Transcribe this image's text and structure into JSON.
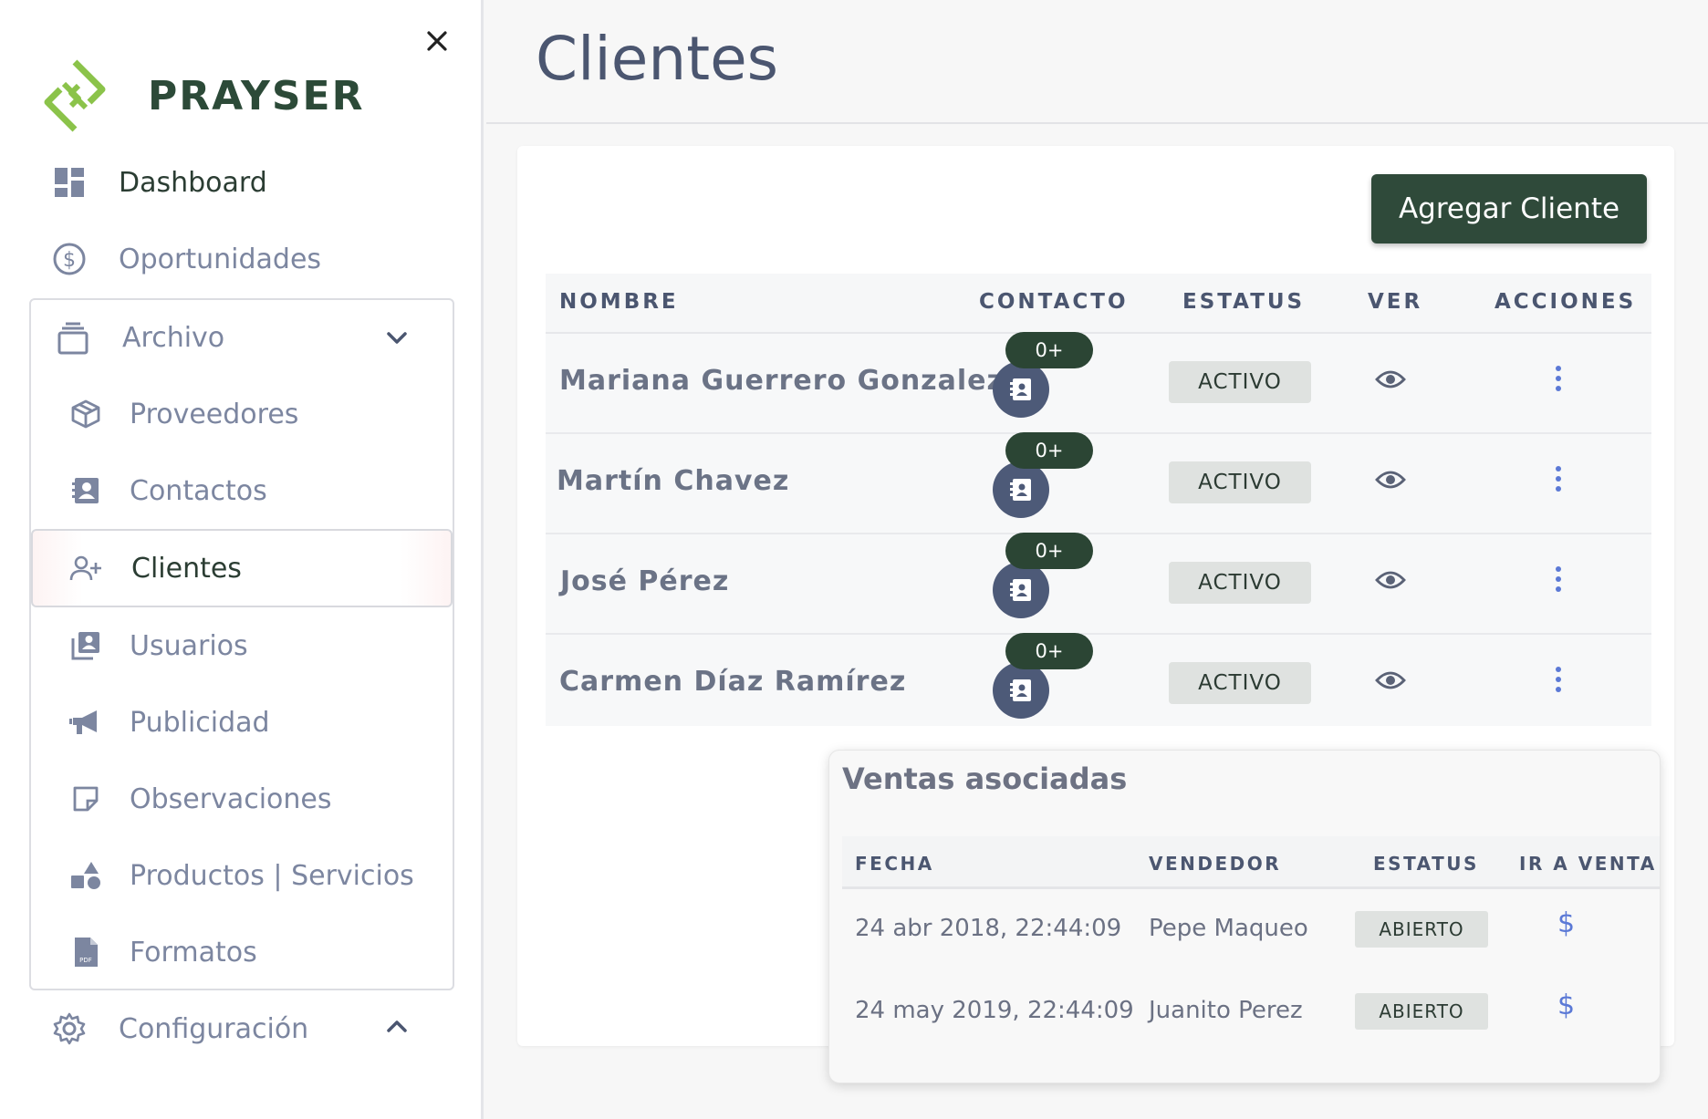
{
  "brand": {
    "name": "PRAYSER",
    "color": "#2c4a38",
    "accent": "#8bc34a"
  },
  "sidebar": {
    "items": [
      {
        "label": "Dashboard",
        "icon": "dashboard-icon"
      },
      {
        "label": "Oportunidades",
        "icon": "dollar-circle-icon"
      },
      {
        "label": "Archivo",
        "icon": "archive-icon"
      },
      {
        "label": "Proveedores",
        "icon": "box-icon"
      },
      {
        "label": "Contactos",
        "icon": "contact-book-icon"
      },
      {
        "label": "Clientes",
        "icon": "user-plus-icon",
        "active": true
      },
      {
        "label": "Usuarios",
        "icon": "user-cards-icon"
      },
      {
        "label": "Publicidad",
        "icon": "megaphone-icon"
      },
      {
        "label": "Observaciones",
        "icon": "note-icon"
      },
      {
        "label": "Productos | Servicios",
        "icon": "shapes-icon"
      },
      {
        "label": "Formatos",
        "icon": "pdf-file-icon"
      },
      {
        "label": "Configuración",
        "icon": "gear-icon"
      }
    ]
  },
  "page": {
    "title": "Clientes"
  },
  "actions": {
    "add_label": "Agregar Cliente"
  },
  "table": {
    "columns": [
      "NOMBRE",
      "CONTACTO",
      "ESTATUS",
      "VER",
      "ACCIONES"
    ],
    "rows": [
      {
        "name": "Mariana Guerrero Gonzalez",
        "contact_badge": "0+",
        "status": "ACTIVO"
      },
      {
        "name": "Martín Chavez",
        "contact_badge": "0+",
        "status": "ACTIVO"
      },
      {
        "name": "José Pérez",
        "contact_badge": "0+",
        "status": "ACTIVO"
      },
      {
        "name": "Carmen Díaz Ramírez",
        "contact_badge": "0+",
        "status": "ACTIVO"
      }
    ]
  },
  "ventas": {
    "title": "Ventas asociadas",
    "columns": [
      "FECHA",
      "VENDEDOR",
      "ESTATUS",
      "IR A VENTA"
    ],
    "rows": [
      {
        "fecha": "24 abr 2018, 22:44:09",
        "vendedor": "Pepe Maqueo",
        "estatus": "ABIERTO",
        "link": "$"
      },
      {
        "fecha": "24 may 2019, 22:44:09",
        "vendedor": "Juanito Perez",
        "estatus": "ABIERTO",
        "link": "$"
      }
    ]
  }
}
